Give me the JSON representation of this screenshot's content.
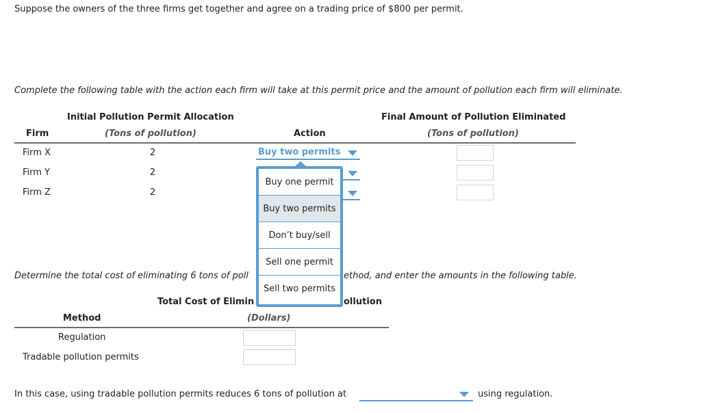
{
  "intro_text": "Suppose the owners of the three firms get together and agree on a trading price of $800 per permit.",
  "instruction_1": "Complete the following table with the action each firm will take at this permit price and the amount of pollution each firm will eliminate.",
  "table1": {
    "headers": {
      "firm": "Firm",
      "allocation_title": "Initial Pollution Permit Allocation",
      "allocation_units": "(Tons of pollution)",
      "action": "Action",
      "eliminated_title": "Final Amount of Pollution Eliminated",
      "eliminated_units": "(Tons of pollution)"
    },
    "rows": [
      {
        "firm": "Firm X",
        "allocation": "2",
        "action": "Buy two permits",
        "eliminated": ""
      },
      {
        "firm": "Firm Y",
        "allocation": "2",
        "action": "",
        "eliminated": ""
      },
      {
        "firm": "Firm Z",
        "allocation": "2",
        "action": "",
        "eliminated": ""
      }
    ]
  },
  "action_dropdown": {
    "open_for": "Firm X",
    "highlighted": "Buy two permits",
    "options": [
      "Buy one permit",
      "Buy two permits",
      "Don’t buy/sell",
      "Sell one permit",
      "Sell two permits"
    ]
  },
  "instruction_2": "Determine the total cost of eliminating 6 tons of pollution using each method, and enter the amounts in the following table.",
  "instruction_2_visible_left": "Determine the total cost of eliminating 6 tons of poll",
  "instruction_2_visible_right": "ethod, and enter the amounts in the following table.",
  "table2": {
    "headers": {
      "method": "Method",
      "cost_title_left": "Total Cost of Elimin",
      "cost_title_right": "ollution",
      "cost_units": "(Dollars)"
    },
    "rows": [
      {
        "method": "Regulation",
        "cost": ""
      },
      {
        "method": "Tradable pollution permits",
        "cost": ""
      }
    ]
  },
  "conclusion": {
    "before": "In this case, using tradable pollution permits reduces 6 tons of pollution at",
    "selected": "",
    "after": "using regulation."
  },
  "colors": {
    "accent": "#5b9bd1",
    "rule": "#6b6b6b",
    "highlight": "#dfe7ea"
  }
}
